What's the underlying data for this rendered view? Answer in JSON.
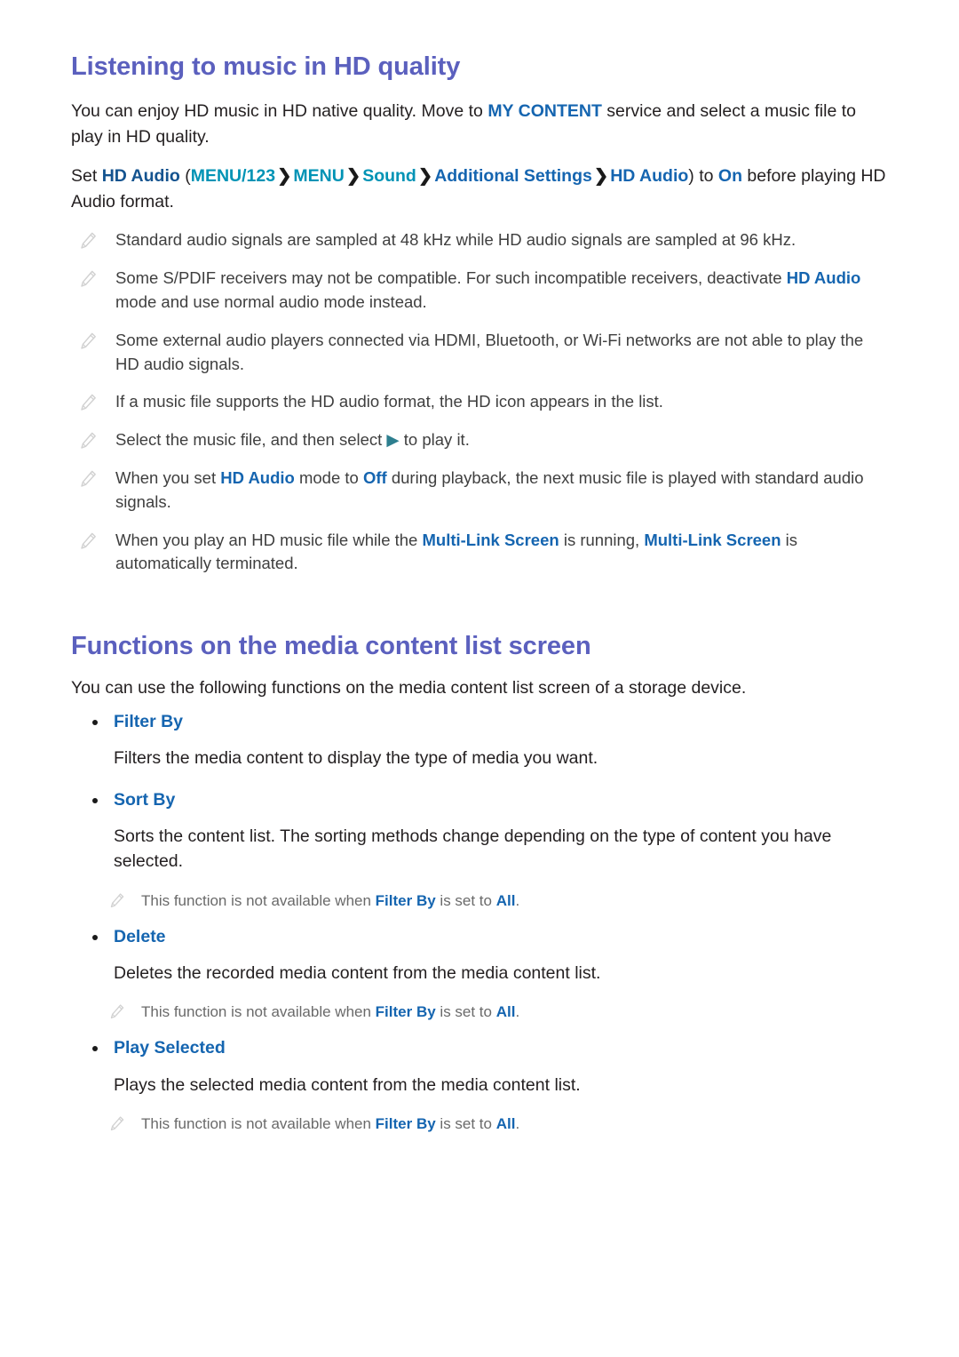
{
  "document": {
    "sections": [
      {
        "id": "hd-quality",
        "heading": "Listening to music in HD quality",
        "intro": {
          "pre": "You can enjoy HD music in HD native quality. Move to ",
          "link": "MY CONTENT",
          "post": " service and select a music file to play in HD quality."
        },
        "path_line": {
          "lead": "Set ",
          "setting": "HD Audio",
          "open_paren": " (",
          "steps": [
            "MENU/123",
            "MENU",
            "Sound",
            "Additional Settings",
            "HD Audio"
          ],
          "separator": "❯",
          "close_paren": ")",
          "mid": " to ",
          "value": "On",
          "tail": " before playing HD Audio format."
        },
        "notes": [
          {
            "icon": "pencil-icon",
            "parts": [
              {
                "t": "Standard audio signals are sampled at 48 kHz while HD audio signals are sampled at 96 kHz.",
                "s": "plain"
              }
            ]
          },
          {
            "icon": "pencil-icon",
            "parts": [
              {
                "t": "Some S/PDIF receivers may not be compatible. For such incompatible receivers, deactivate ",
                "s": "plain"
              },
              {
                "t": "HD Audio",
                "s": "link"
              },
              {
                "t": " mode and use normal audio mode instead.",
                "s": "plain"
              }
            ]
          },
          {
            "icon": "pencil-icon",
            "parts": [
              {
                "t": "Some external audio players connected via HDMI, Bluetooth, or Wi-Fi networks are not able to play the HD audio signals.",
                "s": "plain"
              }
            ]
          },
          {
            "icon": "pencil-icon",
            "parts": [
              {
                "t": "If a music file supports the HD audio format, the HD icon appears in the list.",
                "s": "plain"
              }
            ]
          },
          {
            "icon": "pencil-icon",
            "parts": [
              {
                "t": "Select the music file, and then select ",
                "s": "plain"
              },
              {
                "t": "▶",
                "s": "play"
              },
              {
                "t": " to play it.",
                "s": "plain"
              }
            ]
          },
          {
            "icon": "pencil-icon",
            "parts": [
              {
                "t": "When you set ",
                "s": "plain"
              },
              {
                "t": "HD Audio",
                "s": "link"
              },
              {
                "t": " mode to ",
                "s": "plain"
              },
              {
                "t": "Off",
                "s": "link"
              },
              {
                "t": " during playback, the next music file is played with standard audio signals.",
                "s": "plain"
              }
            ]
          },
          {
            "icon": "pencil-icon",
            "parts": [
              {
                "t": "When you play an HD music file while the ",
                "s": "plain"
              },
              {
                "t": "Multi-Link Screen",
                "s": "link"
              },
              {
                "t": " is running, ",
                "s": "plain"
              },
              {
                "t": "Multi-Link Screen",
                "s": "link"
              },
              {
                "t": " is automatically terminated.",
                "s": "plain"
              }
            ]
          }
        ]
      },
      {
        "id": "media-content-list",
        "heading": "Functions on the media content list screen",
        "intro_plain": "You can use the following functions on the media content list screen of a storage device.",
        "functions": [
          {
            "label": "Filter By",
            "description": "Filters the media content to display the type of media you want.",
            "subnote": null
          },
          {
            "label": "Sort By",
            "description": "Sorts the content list. The sorting methods change depending on the type of content you have selected.",
            "subnote": {
              "icon": "pencil-icon",
              "pre": "This function is not available when ",
              "term": "Filter By",
              "mid": " is set to ",
              "value": "All",
              "post": "."
            }
          },
          {
            "label": "Delete",
            "description": "Deletes the recorded media content from the media content list.",
            "subnote": {
              "icon": "pencil-icon",
              "pre": "This function is not available when ",
              "term": "Filter By",
              "mid": " is set to ",
              "value": "All",
              "post": "."
            }
          },
          {
            "label": "Play Selected",
            "description": "Plays the selected media content from the media content list.",
            "subnote": {
              "icon": "pencil-icon",
              "pre": "This function is not available when ",
              "term": "Filter By",
              "mid": " is set to ",
              "value": "All",
              "post": "."
            }
          }
        ]
      }
    ],
    "colors": {
      "heading": "#5b60be",
      "link": "#1565b0",
      "link_navy": "#14538f",
      "link_teal": "#0093b5",
      "body_text": "#231f20",
      "note_text": "#3f3f3f",
      "subnote_text": "#6a6a6a",
      "play_icon": "#2d7f8f",
      "background": "#ffffff"
    }
  }
}
